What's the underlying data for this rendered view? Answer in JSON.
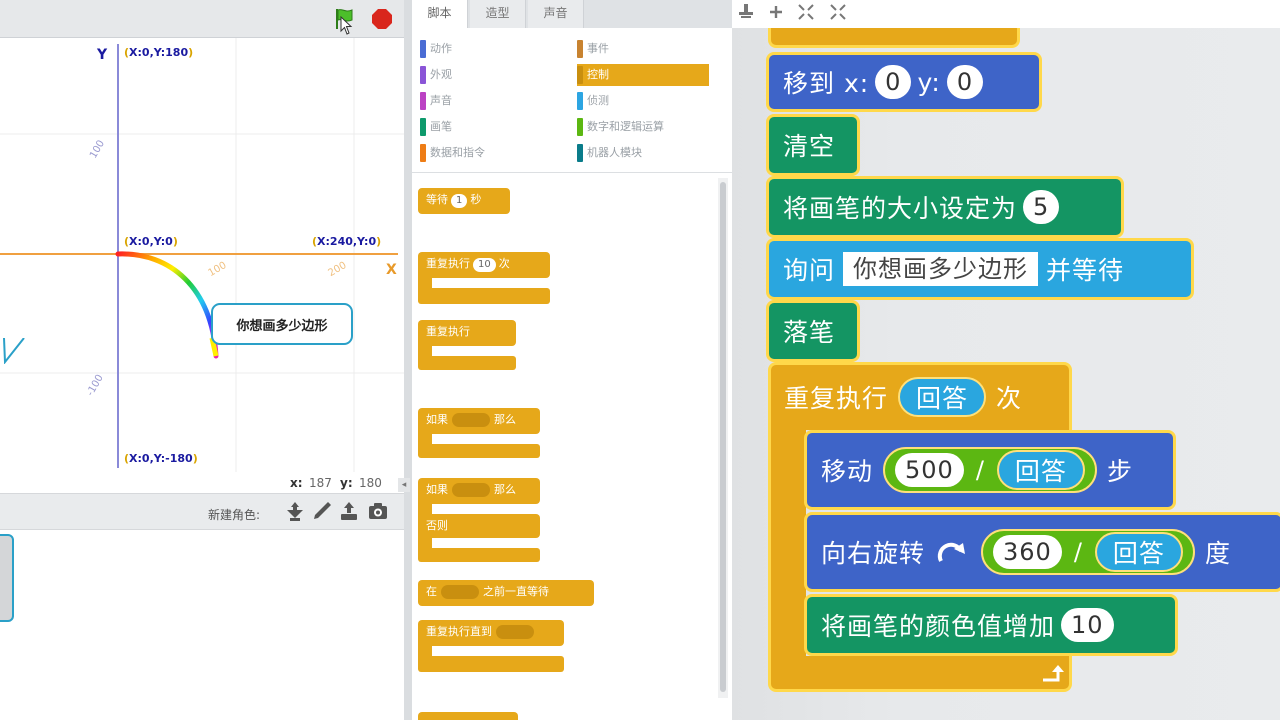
{
  "stage": {
    "coords": {
      "top_center": "X:0,Y:180",
      "center": "X:0,Y:0",
      "right_center": "X:240,Y:0",
      "bottom_center": "X:0,Y:-180"
    },
    "axis_y_letter": "Y",
    "axis_x_letter": "X",
    "ticks": {
      "y_pos": "100",
      "y_neg": "-100",
      "x_100": "100",
      "x_200": "200"
    },
    "speech_bubble": "你想画多少边形"
  },
  "mouse": {
    "x_label": "x:",
    "x_value": "187",
    "y_label": "y:",
    "y_value": "180"
  },
  "sprites": {
    "new_sprite_label": "新建角色:"
  },
  "tabs": [
    {
      "label": "脚本"
    },
    {
      "label": "造型"
    },
    {
      "label": "声音"
    }
  ],
  "categories": [
    {
      "label": "动作",
      "color": "#4a6cd4"
    },
    {
      "label": "外观",
      "color": "#8a55d7"
    },
    {
      "label": "声音",
      "color": "#bb42c3"
    },
    {
      "label": "画笔",
      "color": "#0e9a6c"
    },
    {
      "label": "数据和指令",
      "color": "#ee7d16"
    },
    {
      "label": "事件",
      "color": "#c88330"
    },
    {
      "label": "控制",
      "color": "#e6a81a"
    },
    {
      "label": "侦测",
      "color": "#2ca5e2"
    },
    {
      "label": "数字和逻辑运算",
      "color": "#5cb712"
    },
    {
      "label": "机器人模块",
      "color": "#0a7c8a"
    }
  ],
  "palette": {
    "wait": {
      "label": "等待",
      "value": "1",
      "unit": "秒"
    },
    "repeat": {
      "label": "重复执行",
      "value": "10",
      "unit": "次"
    },
    "forever": {
      "label": "重复执行"
    },
    "if_then": {
      "label_a": "如果",
      "label_b": "那么"
    },
    "if_else": {
      "label_a": "如果",
      "label_b": "那么",
      "else": "否则"
    },
    "wait_until": {
      "label_a": "在",
      "label_b": "之前一直等待"
    },
    "repeat_until": {
      "label": "重复执行直到"
    }
  },
  "script": {
    "goto": {
      "label_a": "移到 x:",
      "x": "0",
      "label_b": "y:",
      "y": "0"
    },
    "clear": {
      "label": "清空"
    },
    "set_pen_size": {
      "label": "将画笔的大小设定为",
      "value": "5"
    },
    "ask": {
      "label_a": "询问",
      "text": "你想画多少边形",
      "label_b": "并等待"
    },
    "pen_down": {
      "label": "落笔"
    },
    "repeat": {
      "label_a": "重复执行",
      "answer": "回答",
      "label_b": "次"
    },
    "move": {
      "label_a": "移动",
      "num": "500",
      "slash": "/",
      "answer": "回答",
      "label_b": "步"
    },
    "turn": {
      "label_a": "向右旋转",
      "num": "360",
      "slash": "/",
      "answer": "回答",
      "label_b": "度"
    },
    "change_pen_color": {
      "label": "将画笔的颜色值增加",
      "value": "10"
    }
  },
  "colors": {
    "motion": "#3e64c8",
    "pen": "#149563",
    "sensing": "#2aa6df",
    "control": "#e6a81a",
    "operators": "#5cb712",
    "highlight": "#ffd84a"
  }
}
